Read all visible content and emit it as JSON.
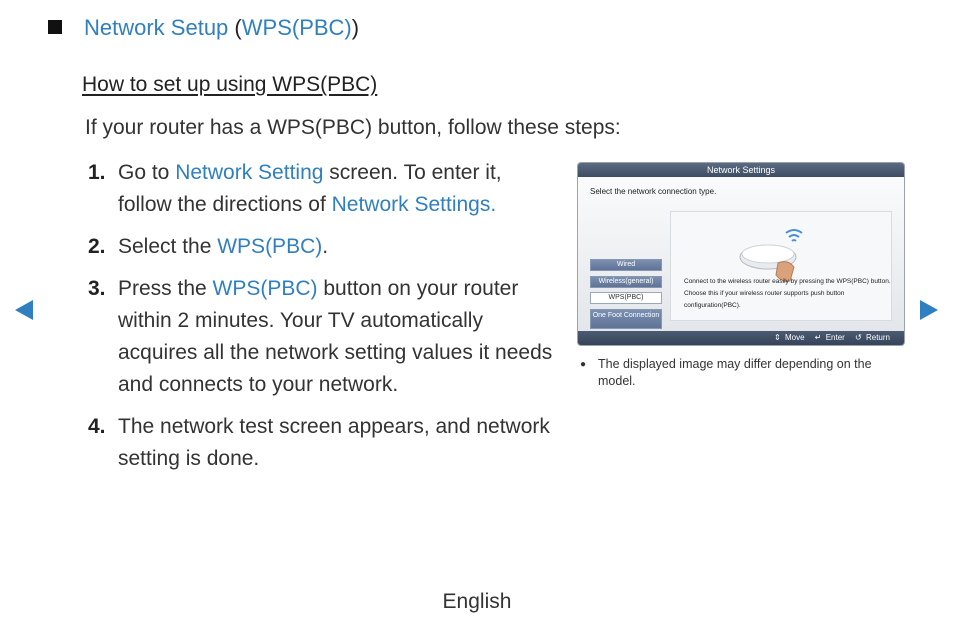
{
  "header": {
    "title_main": "Network Setup",
    "title_open": " (",
    "title_sub": "WPS(PBC)",
    "title_close": ")"
  },
  "subtitle": "How to set up using WPS(PBC)",
  "intro": "If your router has a WPS(PBC) button, follow these steps:",
  "steps": [
    {
      "num": "1.",
      "pre": "Go to ",
      "link1": "Network Setting",
      "mid": " screen. To enter it, follow the directions of ",
      "link2": "Network Settings."
    },
    {
      "num": "2.",
      "pre": "Select the ",
      "link1": "WPS(PBC)",
      "post": "."
    },
    {
      "num": "3.",
      "pre": "Press the ",
      "link1": "WPS(PBC)",
      "post": " button on your router within 2 minutes. Your TV automatically acquires all the network setting values it needs and connects to your network."
    },
    {
      "num": "4.",
      "text": "The network test screen appears, and network setting is done."
    }
  ],
  "screenshot": {
    "title": "Network Settings",
    "prompt": "Select the network connection type.",
    "options": [
      "Wired",
      "Wireless(general)",
      "WPS(PBC)",
      "One Foot Connection"
    ],
    "selected_option": "WPS(PBC)",
    "description": "Connect to the wireless router easily by pressing the WPS(PBC) button. Choose this if your wireless router supports push button configuration(PBC).",
    "footer": {
      "move": "Move",
      "enter": "Enter",
      "return": "Return"
    }
  },
  "note": {
    "bullet": "●",
    "text": "The displayed image may differ depending on the model."
  },
  "nav": {
    "prev_icon": "triangle-left-icon",
    "next_icon": "triangle-right-icon"
  },
  "footer": {
    "language": "English"
  },
  "colors": {
    "accent": "#2f7fc1",
    "text": "#333333"
  }
}
